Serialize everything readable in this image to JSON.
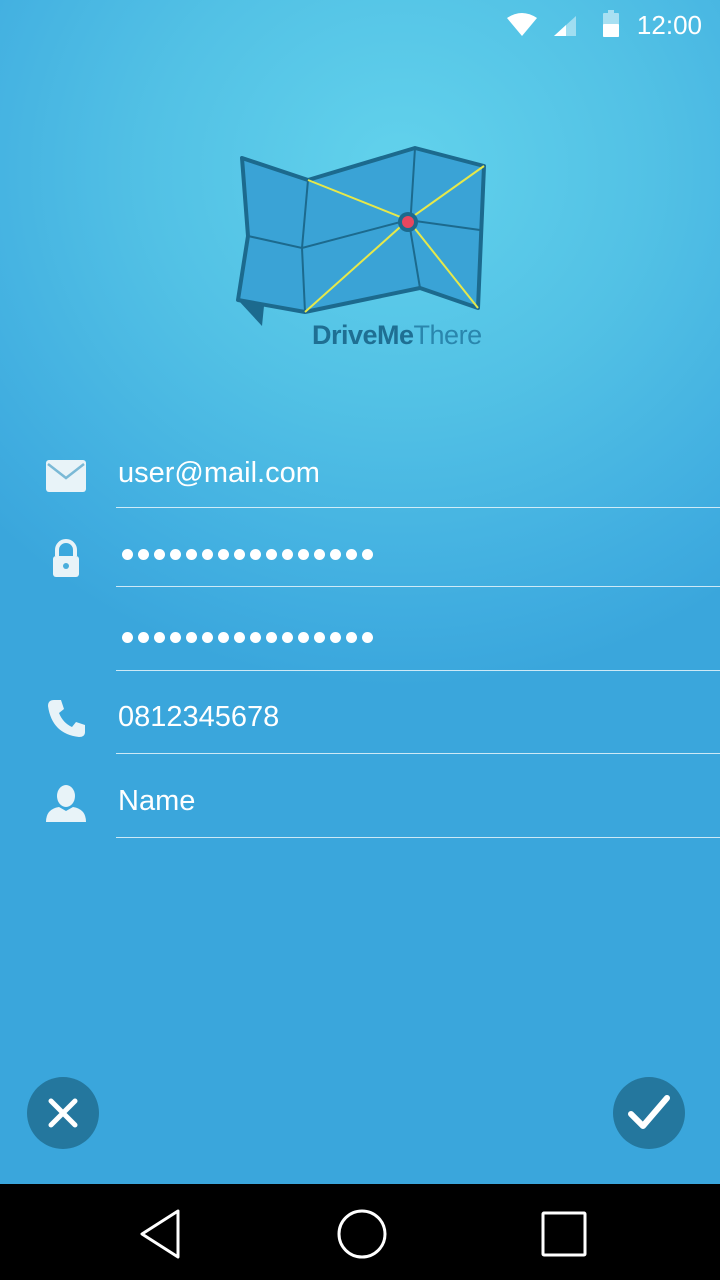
{
  "status_bar": {
    "time": "12:00",
    "icons": [
      "wifi-icon",
      "signal-icon",
      "battery-icon"
    ]
  },
  "logo": {
    "brand_bold": "DriveMe",
    "brand_light": "There"
  },
  "form": {
    "email": {
      "value": "user@mail.com",
      "icon": "mail-icon"
    },
    "password": {
      "masked_length": 16,
      "icon": "lock-icon"
    },
    "confirm_password": {
      "masked_length": 16
    },
    "phone": {
      "value": "0812345678",
      "icon": "phone-icon"
    },
    "name": {
      "placeholder": "Name",
      "icon": "person-icon"
    }
  },
  "actions": {
    "cancel_icon": "close-icon",
    "confirm_icon": "check-icon"
  },
  "nav_bar": {
    "buttons": [
      "back-icon",
      "home-icon",
      "recents-icon"
    ]
  },
  "colors": {
    "accent": "#24779e",
    "brand_dark": "#1f6f93",
    "brand_light": "#2a86ad",
    "map_fill": "#3aa3d6",
    "route": "#e6e84a",
    "pin": "#e8475f"
  }
}
